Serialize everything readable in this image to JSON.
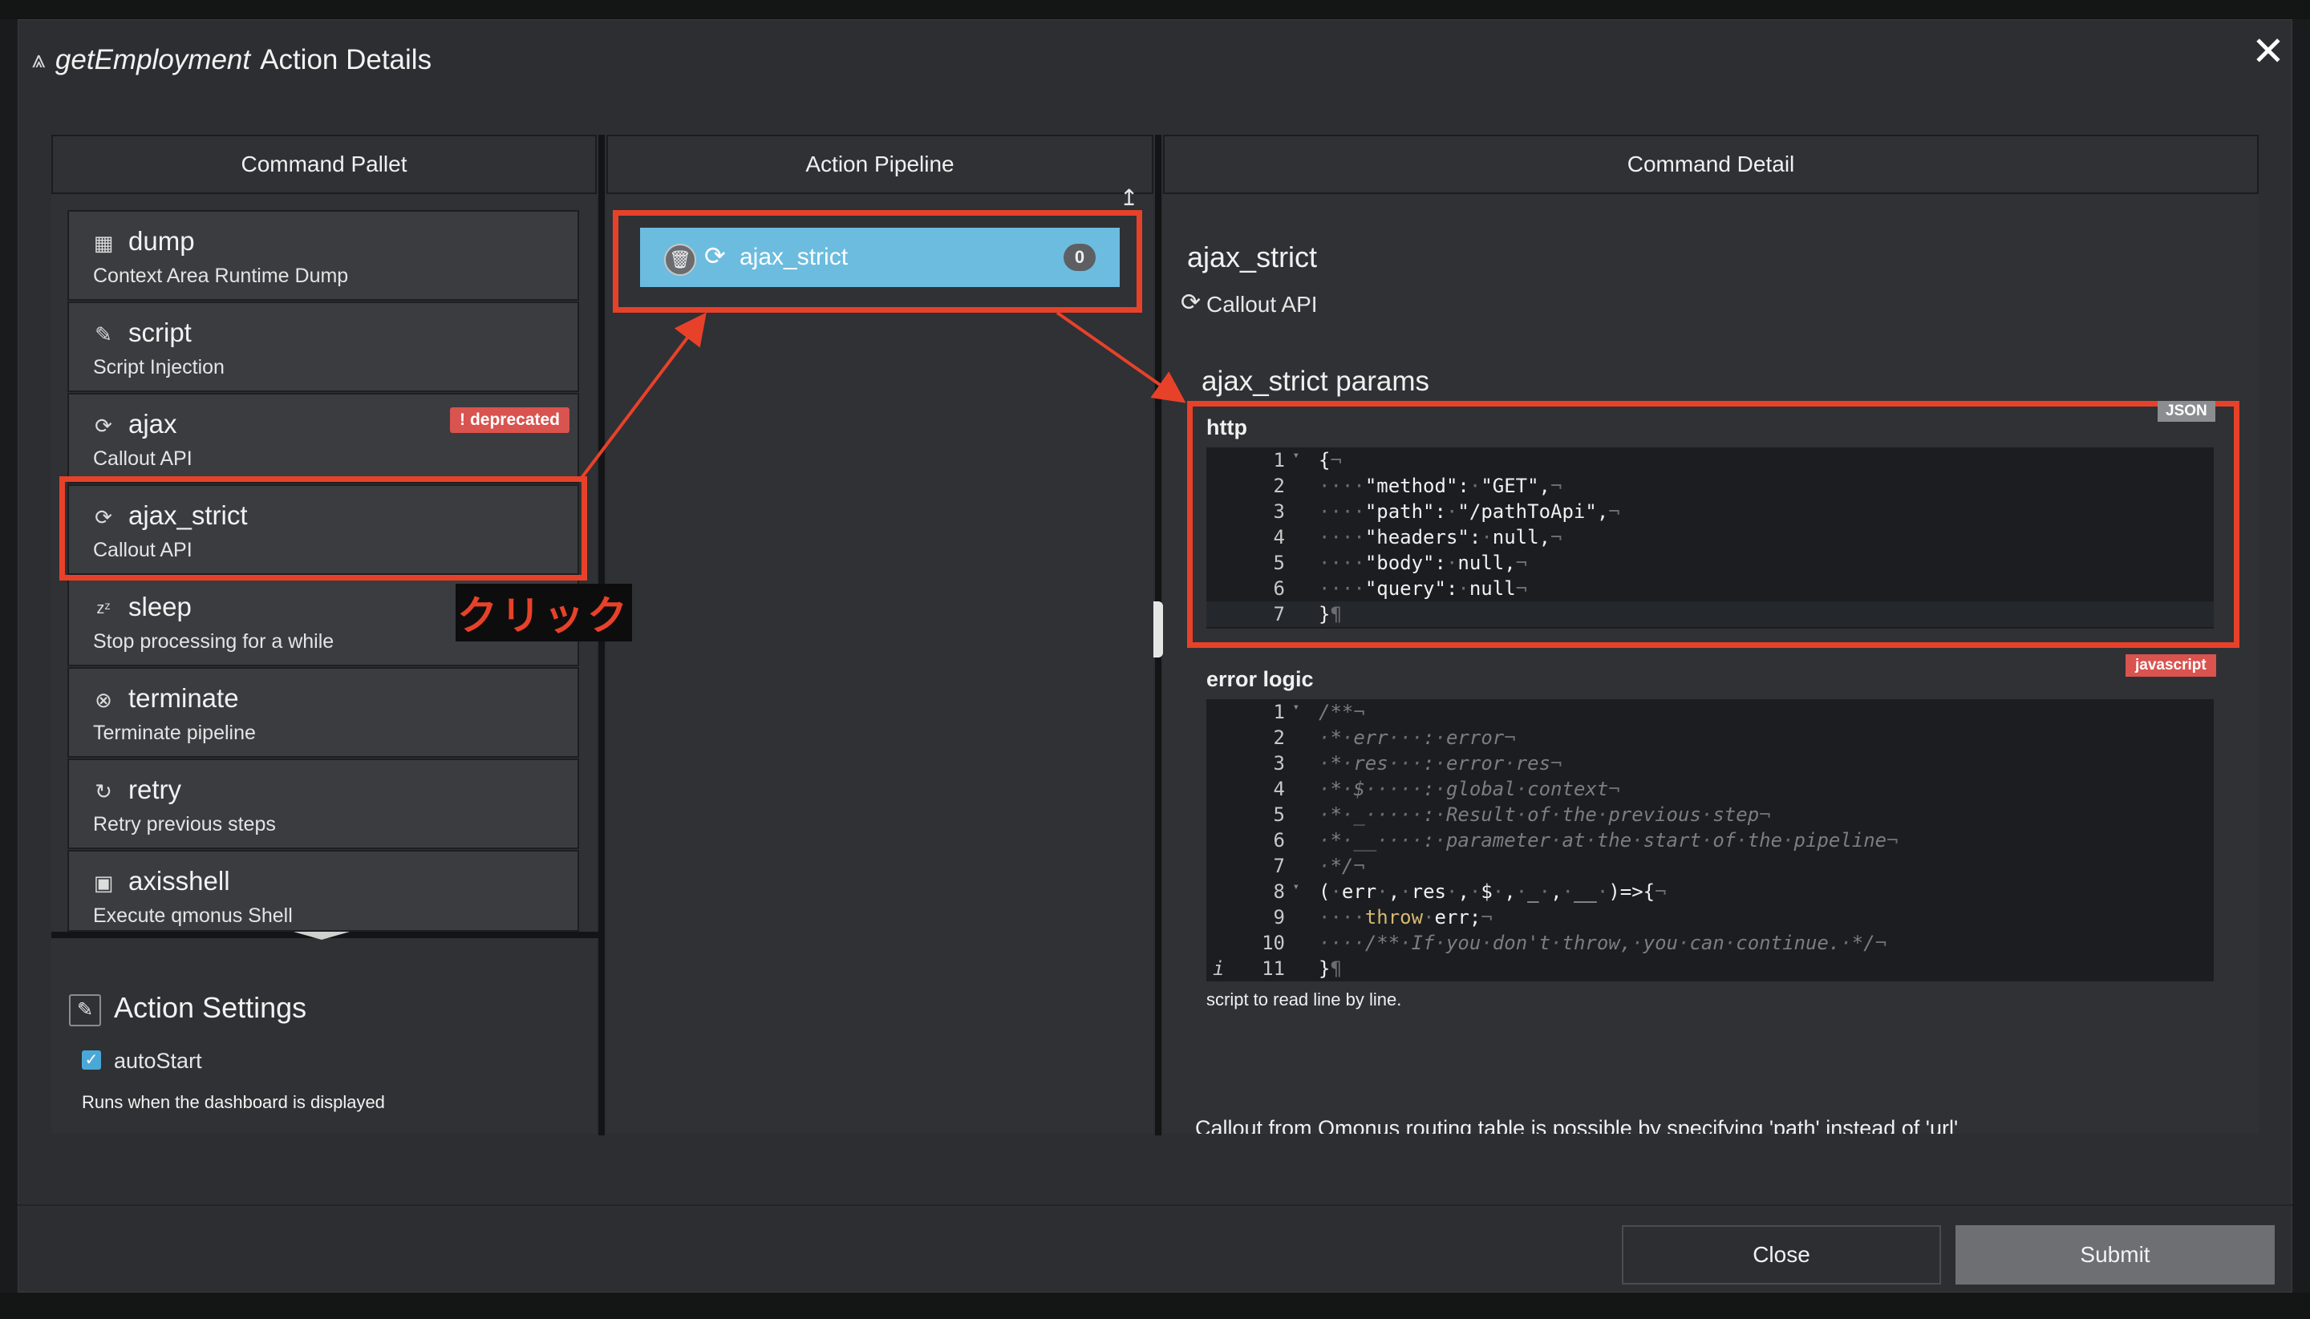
{
  "modal": {
    "title_function": "getEmployment",
    "title_suffix": "Action Details",
    "close_symbol": "✕"
  },
  "columns": {
    "palette": "Command Pallet",
    "pipeline": "Action Pipeline",
    "detail": "Command Detail"
  },
  "palette": {
    "items": [
      {
        "name": "dump",
        "desc": "Context Area Runtime Dump",
        "icon": "dump-icon"
      },
      {
        "name": "script",
        "desc": "Script Injection",
        "icon": "script-icon"
      },
      {
        "name": "ajax",
        "desc": "Callout API",
        "icon": "sync-icon",
        "badge": "deprecated"
      },
      {
        "name": "ajax_strict",
        "desc": "Callout API",
        "icon": "sync-icon"
      },
      {
        "name": "sleep",
        "desc": "Stop processing for a while",
        "icon": "sleep-icon"
      },
      {
        "name": "terminate",
        "desc": "Terminate pipeline",
        "icon": "terminate-icon"
      },
      {
        "name": "retry",
        "desc": "Retry previous steps",
        "icon": "retry-icon"
      },
      {
        "name": "axisshell",
        "desc": "Execute qmonus Shell",
        "icon": "terminal-icon"
      }
    ],
    "click_annotation": "クリック"
  },
  "settings": {
    "title": "Action Settings",
    "autostart_label": "autoStart",
    "autostart_checked": true,
    "autostart_help": "Runs when the dashboard is displayed"
  },
  "pipeline": {
    "item_name": "ajax_strict",
    "item_count": "0"
  },
  "detail": {
    "command_name": "ajax_strict",
    "command_desc": "Callout API",
    "params_title": "ajax_strict params",
    "http_label": "http",
    "http_lang": "JSON",
    "error_label": "error logic",
    "error_lang": "javascript",
    "error_help": "script to read line by line.",
    "bottom_note": "Callout from Qmonus routing table is possible by specifying 'path' instead of 'url'"
  },
  "http_lines": [
    "{¬",
    "····\"method\":·\"GET\",¬",
    "····\"path\":·\"/pathToApi\",¬",
    "····\"headers\":·null,¬",
    "····\"body\":·null,¬",
    "····\"query\":·null¬",
    "}¶"
  ],
  "error_lines": [
    "/**¬",
    "·*·err···:·error¬",
    "·*·res···:·error·res¬",
    "·*·$·····:·global·context¬",
    "·*·_·····:·Result·of·the·previous·step¬",
    "·*·__····:·parameter·at·the·start·of·the·pipeline¬",
    "·*/¬",
    "(·err·,·res·,·$·,·_·,·__·)=>{¬",
    "····throw·err;¬",
    "····/**·If·you·don't·throw,·you·can·continue.·*/¬",
    "}¶"
  ],
  "footer": {
    "close_label": "Close",
    "submit_label": "Submit"
  },
  "colors": {
    "annotation_red": "#e8412a",
    "pipeline_item": "#6cbcdf",
    "deprecated_badge": "#d9534f",
    "json_tag": "#8b8d90"
  }
}
